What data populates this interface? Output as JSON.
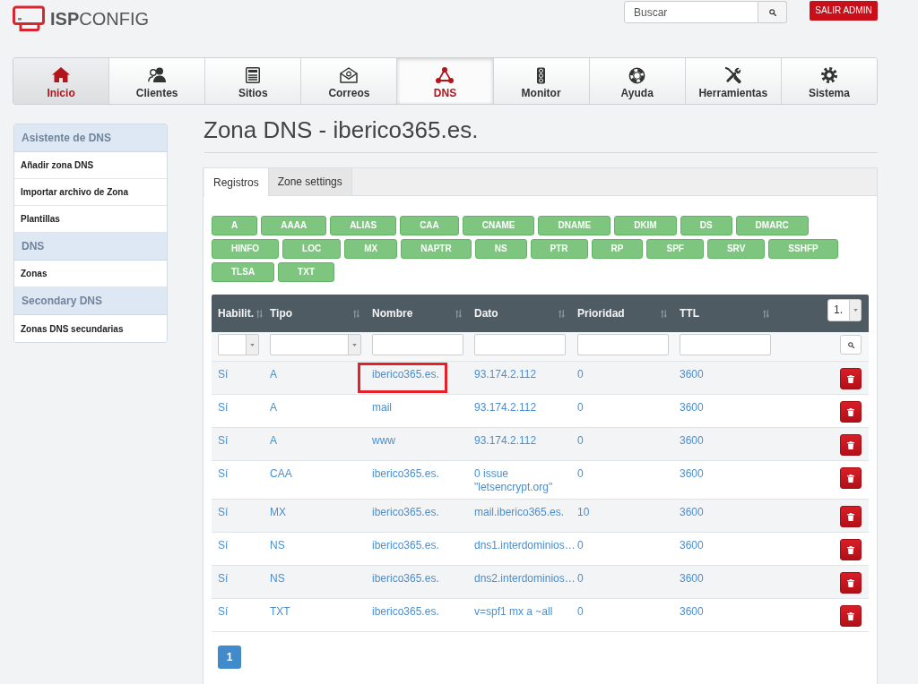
{
  "header": {
    "logo": "**ISP**CONFIG",
    "search": {
      "placeholder": "Buscar"
    },
    "logout_button": "SALIR ADMIN"
  },
  "nav": [
    {
      "label": "Inicio",
      "selected": false,
      "highlighted": true
    },
    {
      "label": "Clientes",
      "selected": false,
      "highlighted": false
    },
    {
      "label": "Sitios",
      "selected": false,
      "highlighted": false
    },
    {
      "label": "Correos",
      "selected": false,
      "highlighted": false
    },
    {
      "label": "DNS",
      "selected": true,
      "highlighted": true
    },
    {
      "label": "Monitor",
      "selected": false,
      "highlighted": false
    },
    {
      "label": "Ayuda",
      "selected": false,
      "highlighted": false
    },
    {
      "label": "Herramientas",
      "selected": false,
      "highlighted": false
    },
    {
      "label": "Sistema",
      "selected": false,
      "highlighted": false
    }
  ],
  "sidebar": [
    {
      "title": "Asistente de DNS",
      "items": [
        "Añadir zona DNS",
        "Importar archivo de Zona",
        "Plantillas"
      ]
    },
    {
      "title": "DNS",
      "items": [
        "Zonas"
      ]
    },
    {
      "title": "Secondary DNS",
      "items": [
        "Zonas DNS secundarias"
      ]
    }
  ],
  "page_title": "Zona DNS - iberico365.es.",
  "tabs": [
    {
      "label": "Registros",
      "selected": true
    },
    {
      "label": "Zone settings",
      "selected": false
    }
  ],
  "record_type_buttons": [
    "A",
    "AAAA",
    "ALIAS",
    "CAA",
    "CNAME",
    "DNAME",
    "DKIM",
    "DS",
    "DMARC",
    "HINFO",
    "LOC",
    "MX",
    "NAPTR",
    "NS",
    "PTR",
    "RP",
    "SPF",
    "SRV",
    "SSHFP",
    "TLSA",
    "TXT"
  ],
  "table": {
    "columns": [
      {
        "label": "Habilit.",
        "kind": "select"
      },
      {
        "label": "Tipo",
        "kind": "select"
      },
      {
        "label": "Nombre",
        "kind": "text"
      },
      {
        "label": "Dato",
        "kind": "text"
      },
      {
        "label": "Prioridad",
        "kind": "text"
      },
      {
        "label": "TTL",
        "kind": "text"
      }
    ],
    "page_size": "1.",
    "rows": [
      {
        "enabled": "Sí",
        "type": "A",
        "name": "iberico365.es.",
        "data": "93.174.2.112",
        "priority": "0",
        "ttl": "3600",
        "marked": true
      },
      {
        "enabled": "Sí",
        "type": "A",
        "name": "mail",
        "data": "93.174.2.112",
        "priority": "0",
        "ttl": "3600",
        "marked": false
      },
      {
        "enabled": "Sí",
        "type": "A",
        "name": "www",
        "data": "93.174.2.112",
        "priority": "0",
        "ttl": "3600",
        "marked": false
      },
      {
        "enabled": "Sí",
        "type": "CAA",
        "name": "iberico365.es.",
        "data": "0 issue \"letsencrypt.org\"",
        "priority": "0",
        "ttl": "3600",
        "marked": false
      },
      {
        "enabled": "Sí",
        "type": "MX",
        "name": "iberico365.es.",
        "data": "mail.iberico365.es.",
        "priority": "10",
        "ttl": "3600",
        "marked": false
      },
      {
        "enabled": "Sí",
        "type": "NS",
        "name": "iberico365.es.",
        "data": "dns1.interdominios…",
        "priority": "0",
        "ttl": "3600",
        "marked": false
      },
      {
        "enabled": "Sí",
        "type": "NS",
        "name": "iberico365.es.",
        "data": "dns2.interdominios…",
        "priority": "0",
        "ttl": "3600",
        "marked": false
      },
      {
        "enabled": "Sí",
        "type": "TXT",
        "name": "iberico365.es.",
        "data": "v=spf1 mx a ~all",
        "priority": "0",
        "ttl": "3600",
        "marked": false
      }
    ],
    "pagination": [
      {
        "label": "1",
        "selected": true
      }
    ]
  }
}
